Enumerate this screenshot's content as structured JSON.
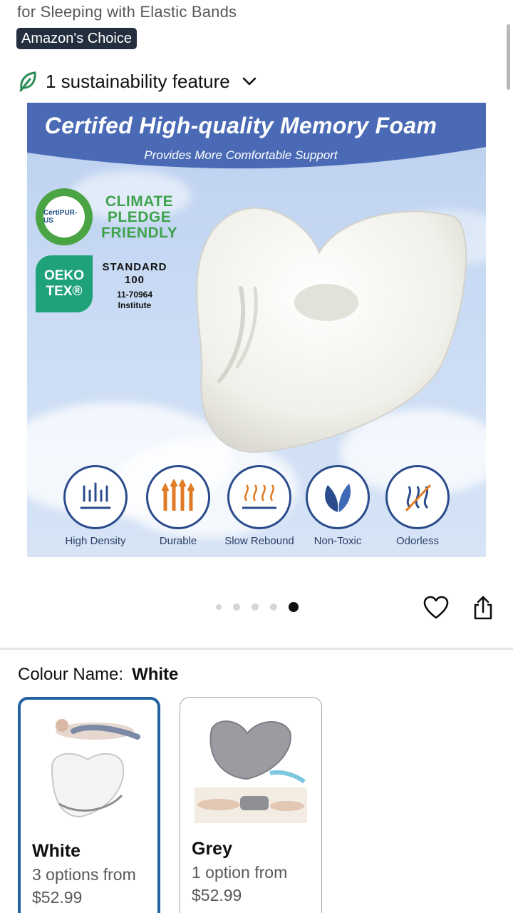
{
  "header": {
    "title_fragment": "for Sleeping with Elastic Bands",
    "badge": "Amazon's Choice",
    "sustainability": "1 sustainability feature"
  },
  "hero": {
    "banner_title": "Certifed High-quality Memory Foam",
    "banner_subtitle": "Provides More Comfortable Support",
    "certipur_label": "CertiPUR-US",
    "climate_lines": [
      "CLIMATE",
      "PLEDGE",
      "FRIENDLY"
    ],
    "oeko_lines": [
      "OEKO",
      "TEX®"
    ],
    "standard_lines": [
      "STANDARD",
      "100",
      "11-70964",
      "Institute"
    ],
    "features": [
      "High Density",
      "Durable",
      "Slow Rebound",
      "Non-Toxic",
      "Odorless"
    ]
  },
  "carousel": {
    "total_dots": 5,
    "active_index": 4
  },
  "icons": {
    "wishlist": "heart-icon",
    "share": "share-icon",
    "sustainability": "leaf-icon",
    "expand": "chevron-down-icon"
  },
  "colour": {
    "label": "Colour Name:",
    "selected": "White",
    "options": [
      {
        "name": "White",
        "options_text": "3 options from",
        "price": "$52.99"
      },
      {
        "name": "Grey",
        "options_text": "1 option from",
        "price": "$52.99"
      }
    ]
  },
  "colors": {
    "badge_bg": "#232f3e",
    "selected_border": "#2162a1",
    "banner_blue": "#4a6ab5",
    "leaf_green": "#2e8b57"
  }
}
